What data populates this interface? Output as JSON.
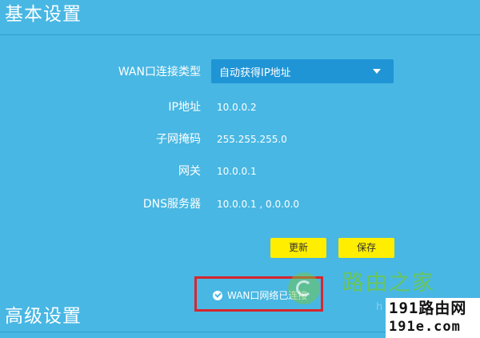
{
  "sections": {
    "basic_title": "基本设置",
    "advanced_title": "高级设置"
  },
  "form": {
    "wan_type_label": "WAN口连接类型",
    "wan_type_value": "自动获得IP地址",
    "ip_label": "IP地址",
    "ip_value": "10.0.0.2",
    "mask_label": "子网掩码",
    "mask_value": "255.255.255.0",
    "gateway_label": "网关",
    "gateway_value": "10.0.0.1",
    "dns_label": "DNS服务器",
    "dns_value": "10.0.0.1 , 0.0.0.0"
  },
  "buttons": {
    "refresh_label": "更新",
    "save_label": "保存"
  },
  "status": {
    "text": "WAN口网络已连接",
    "highlight_color": "#d7262e"
  },
  "watermark": {
    "brand_text": "路由之家",
    "site_fragment": "h",
    "badge_line1": "191路由网",
    "badge_line2": "191e.com"
  },
  "colors": {
    "background": "#48b7e3",
    "select_bg": "#1f95d6",
    "button_bg": "#ffee00"
  },
  "icons": {
    "select_arrow": "caret-down-icon",
    "status": "check-circle-icon",
    "watermark_logo": "logo-icon"
  }
}
